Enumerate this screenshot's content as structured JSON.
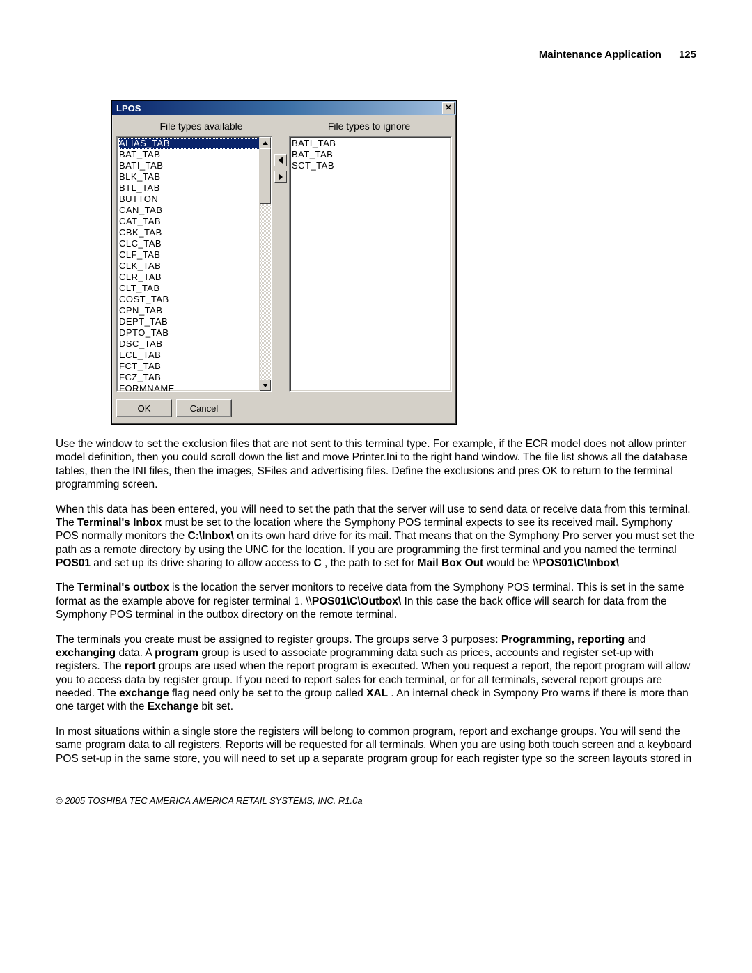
{
  "header": {
    "section_title": "Maintenance Application",
    "page_number": "125"
  },
  "dialog": {
    "title": "LPOS",
    "label_available": "File types available",
    "label_ignore": "File types to ignore",
    "available_items": [
      "ALIAS_TAB",
      "BAT_TAB",
      "BATI_TAB",
      "BLK_TAB",
      "BTL_TAB",
      "BUTTON",
      "CAN_TAB",
      "CAT_TAB",
      "CBK_TAB",
      "CLC_TAB",
      "CLF_TAB",
      "CLK_TAB",
      "CLR_TAB",
      "CLT_TAB",
      "COST_TAB",
      "CPN_TAB",
      "DEPT_TAB",
      "DPTO_TAB",
      "DSC_TAB",
      "ECL_TAB",
      "FCT_TAB",
      "FCZ_TAB",
      "FORMNAME"
    ],
    "ignore_items": [
      "BATI_TAB",
      "BAT_TAB",
      "SCT_TAB"
    ],
    "ok": "OK",
    "cancel": "Cancel"
  },
  "body": {
    "p1": "Use the window to set the exclusion files that are not sent to this terminal type. For example, if the ECR model does not allow printer model definition, then you could scroll down the list and move Printer.Ini to the right hand window. The file list shows all the database tables, then the INI files, then the images, SFiles and advertising files. Define the exclusions and pres OK to return to the terminal programming screen.",
    "p2a": " When this data has been entered, you will need to set the path that the server will use to send data or receive data from this terminal. The ",
    "p2_b1": "Terminal's Inbox",
    "p2b": "  must be set to the location where the Symphony POS terminal expects to see its received mail. Symphony POS normally monitors the ",
    "p2_b2": "C:\\Inbox\\",
    "p2c": "  on its own hard drive for its mail. That means that on the Symphony Pro server you must set the path as a remote directory by using the UNC for the location. If you are programming the first terminal and you named the terminal ",
    "p2_b3": "POS01",
    "p2d": "  and set up its drive sharing to allow access to ",
    "p2_b4": "C",
    "p2e": " , the path to set for ",
    "p2_b5": "Mail Box Out",
    "p2f": "  would be \\\\",
    "p2_b6": "POS01\\C\\Inbox\\",
    "p3a": " The ",
    "p3_b1": "Terminal's outbox",
    "p3b": "  is the location the server monitors to receive data from the Symphony POS terminal. This is set in the same format as the example above for register terminal 1. \\\\",
    "p3_b2": "POS01\\C\\Outbox\\",
    "p3c": "  In this case the back office will search for data from the Symphony POS terminal in the outbox directory on the remote terminal.",
    "p4a": " The terminals you create must be assigned to register groups. The groups serve 3 purposes: ",
    "p4_b1": "Programming, reporting",
    "p4b": "  and ",
    "p4_b2": "exchanging",
    "p4c": "  data. A ",
    "p4_b3": "program",
    "p4d": "  group is used to associate programming data such as prices, accounts and register set-up with registers. The ",
    "p4_b4": "report",
    "p4e": "  groups are used when the report program is executed. When you request a report, the report program will allow you to access data by register group. If you need to report sales for each terminal, or for all terminals, several report groups are needed. The ",
    "p4_b5": "exchange",
    "p4f": "  flag need only be set to the group called ",
    "p4_b6": "XAL",
    "p4g": " . An internal check in Sympony Pro warns if there is more than one target with the ",
    "p4_b7": "Exchange",
    "p4h": "  bit set.",
    "p5": " In most situations within a single store the registers will belong to common program, report and exchange groups. You will send the same program data to all registers. Reports will be requested for all terminals. When you are using both touch screen and a keyboard POS set-up in the same store, you will need to set up a separate program group for each register type so the screen layouts stored in"
  },
  "footer": {
    "text": "© 2005 TOSHIBA TEC AMERICA AMERICA RETAIL SYSTEMS, INC.   R1.0a"
  }
}
